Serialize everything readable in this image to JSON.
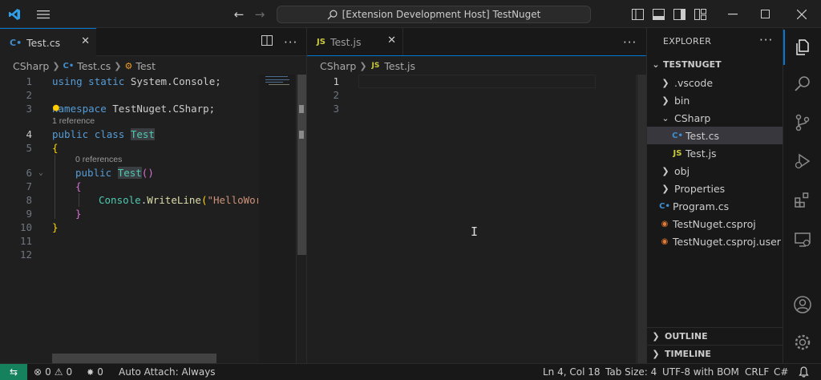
{
  "titlebar": {
    "search_text": "[Extension Development Host] TestNuget"
  },
  "left_editor": {
    "tab_label": "Test.cs",
    "tab_icon": "csharp-icon",
    "breadcrumb": [
      "CSharp",
      "Test.cs",
      "Test"
    ],
    "codelens": {
      "line3": "1 reference",
      "line5": "0 references"
    },
    "line_numbers": [
      "1",
      "2",
      "3",
      "4",
      "5",
      "6",
      "7",
      "8",
      "9",
      "10",
      "11",
      "12"
    ],
    "code": {
      "l1_kw1": "using",
      "l1_kw2": "static",
      "l1_rest": "System.Console;",
      "l3_kw": "namespace",
      "l3_rest": "TestNuget.CSharp;",
      "l4_kw1": "public",
      "l4_kw2": "class",
      "l4_name": "Test",
      "l5_brace": "{",
      "l6_kw": "public",
      "l6_name": "Test",
      "l6_parens": "()",
      "l7_brace": "{",
      "l8_obj": "Console",
      "l8_dot": ".",
      "l8_fn": "WriteLine",
      "l8_paren": "(",
      "l8_str": "\"HelloWor",
      "l9_brace": "}",
      "l10_brace": "}"
    }
  },
  "right_editor": {
    "tab_label": "Test.js",
    "tab_icon_text": "JS",
    "breadcrumb": [
      "CSharp",
      "Test.js"
    ],
    "line_numbers": [
      "1",
      "2",
      "3"
    ]
  },
  "explorer": {
    "header": "EXPLORER",
    "root": "TESTNUGET",
    "items": [
      {
        "label": ".vscode",
        "type": "folder"
      },
      {
        "label": "bin",
        "type": "folder"
      },
      {
        "label": "CSharp",
        "type": "folder-open"
      },
      {
        "label": "Test.cs",
        "type": "cs"
      },
      {
        "label": "Test.js",
        "type": "js"
      },
      {
        "label": "obj",
        "type": "folder"
      },
      {
        "label": "Properties",
        "type": "folder"
      },
      {
        "label": "Program.cs",
        "type": "cs"
      },
      {
        "label": "TestNuget.csproj",
        "type": "rss"
      },
      {
        "label": "TestNuget.csproj.user",
        "type": "rss"
      }
    ],
    "outline": "OUTLINE",
    "timeline": "TIMELINE"
  },
  "statusbar": {
    "errors": "0",
    "warnings": "0",
    "ports": "0",
    "auto_attach": "Auto Attach: Always",
    "position": "Ln 4, Col 18",
    "tab_size": "Tab Size: 4",
    "encoding": "UTF-8 with BOM",
    "eol": "CRLF",
    "language": "C#"
  },
  "colors": {
    "accent": "#0078d4",
    "remote": "#16825d",
    "keyword": "#569cd6",
    "type": "#4ec9b0",
    "function": "#dcdcaa",
    "string": "#ce9178"
  }
}
